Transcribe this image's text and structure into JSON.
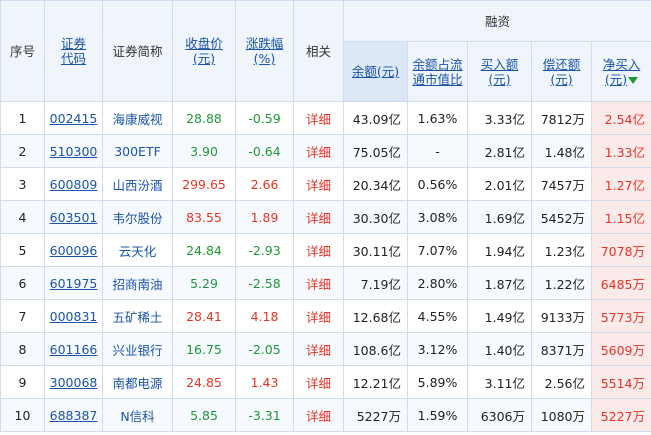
{
  "header": {
    "index": "序号",
    "code": "证券代码",
    "name": "证券简称",
    "close": "收盘价(元)",
    "change": "涨跌幅(%)",
    "related": "相关",
    "group": "融资",
    "balance": "余额(元)",
    "ratio": "余额占流通市值比",
    "buy": "买入额(元)",
    "repay": "偿还额(元)",
    "netbuy": "净买入(元)",
    "sort_icon": "arrow-down-icon"
  },
  "colors": {
    "up": "#e63524",
    "down": "#1d9a35",
    "link": "#1a55a8"
  },
  "rows": [
    {
      "index": "1",
      "code": "002415",
      "name": "海康威视",
      "close": "28.88",
      "change": "-0.59",
      "detail": "详细",
      "balance": "43.09亿",
      "ratio": "1.63%",
      "buy": "3.33亿",
      "repay": "7812万",
      "netbuy": "2.54亿"
    },
    {
      "index": "2",
      "code": "510300",
      "name": "300ETF",
      "close": "3.90",
      "change": "-0.64",
      "detail": "详细",
      "balance": "75.05亿",
      "ratio": "-",
      "buy": "2.81亿",
      "repay": "1.48亿",
      "netbuy": "1.33亿"
    },
    {
      "index": "3",
      "code": "600809",
      "name": "山西汾酒",
      "close": "299.65",
      "change": "2.66",
      "detail": "详细",
      "balance": "20.34亿",
      "ratio": "0.56%",
      "buy": "2.01亿",
      "repay": "7457万",
      "netbuy": "1.27亿"
    },
    {
      "index": "4",
      "code": "603501",
      "name": "韦尔股份",
      "close": "83.55",
      "change": "1.89",
      "detail": "详细",
      "balance": "30.30亿",
      "ratio": "3.08%",
      "buy": "1.69亿",
      "repay": "5452万",
      "netbuy": "1.15亿"
    },
    {
      "index": "5",
      "code": "600096",
      "name": "云天化",
      "close": "24.84",
      "change": "-2.93",
      "detail": "详细",
      "balance": "30.11亿",
      "ratio": "7.07%",
      "buy": "1.94亿",
      "repay": "1.23亿",
      "netbuy": "7078万"
    },
    {
      "index": "6",
      "code": "601975",
      "name": "招商南油",
      "close": "5.29",
      "change": "-2.58",
      "detail": "详细",
      "balance": "7.19亿",
      "ratio": "2.80%",
      "buy": "1.87亿",
      "repay": "1.22亿",
      "netbuy": "6485万"
    },
    {
      "index": "7",
      "code": "000831",
      "name": "五矿稀土",
      "close": "28.41",
      "change": "4.18",
      "detail": "详细",
      "balance": "12.68亿",
      "ratio": "4.55%",
      "buy": "1.49亿",
      "repay": "9133万",
      "netbuy": "5773万"
    },
    {
      "index": "8",
      "code": "601166",
      "name": "兴业银行",
      "close": "16.75",
      "change": "-2.05",
      "detail": "详细",
      "balance": "108.6亿",
      "ratio": "3.12%",
      "buy": "1.40亿",
      "repay": "8371万",
      "netbuy": "5609万"
    },
    {
      "index": "9",
      "code": "300068",
      "name": "南都电源",
      "close": "24.85",
      "change": "1.43",
      "detail": "详细",
      "balance": "12.21亿",
      "ratio": "5.89%",
      "buy": "3.11亿",
      "repay": "2.56亿",
      "netbuy": "5514万"
    },
    {
      "index": "10",
      "code": "688387",
      "name": "N信科",
      "close": "5.85",
      "change": "-3.31",
      "detail": "详细",
      "balance": "5227万",
      "ratio": "1.59%",
      "buy": "6306万",
      "repay": "1080万",
      "netbuy": "5227万"
    }
  ]
}
